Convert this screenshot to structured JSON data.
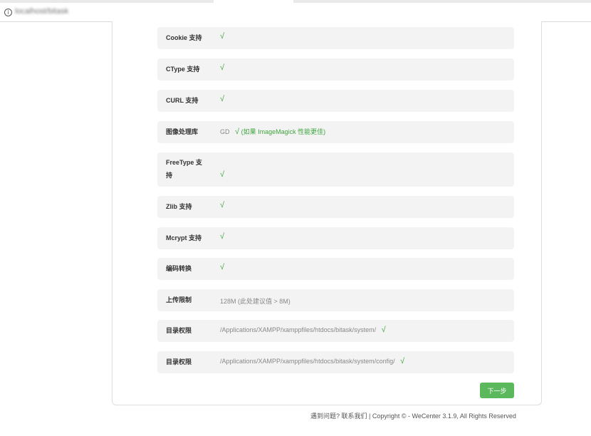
{
  "browser": {
    "url": "localhost/bitask",
    "info_icon": "i"
  },
  "checks": [
    {
      "label": "Cookie 支持",
      "value": "",
      "check": "√",
      "note": ""
    },
    {
      "label": "CType 支持",
      "value": "",
      "check": "√",
      "note": ""
    },
    {
      "label": "CURL 支持",
      "value": "",
      "check": "√",
      "note": ""
    },
    {
      "label": "图像处理库",
      "value": "GD",
      "check": "√",
      "note": "(如果 ImageMagick 性能更佳)"
    },
    {
      "label_line1": "FreeType 支",
      "label_line2": "持",
      "value": "",
      "check": "√",
      "note": ""
    },
    {
      "label": "Zlib 支持",
      "value": "",
      "check": "√",
      "note": ""
    },
    {
      "label": "Mcrypt 支持",
      "value": "",
      "check": "√",
      "note": ""
    },
    {
      "label": "编码转换",
      "value": "",
      "check": "√",
      "note": ""
    },
    {
      "label": "上传限制",
      "value": "128M (此处建议值 > 8M)",
      "check": "",
      "note": ""
    },
    {
      "label": "目录权限",
      "value": "/Applications/XAMPP/xamppfiles/htdocs/bitask/system/",
      "check": "√",
      "note": ""
    },
    {
      "label": "目录权限",
      "value": "/Applications/XAMPP/xamppfiles/htdocs/bitask/system/config/",
      "check": "√",
      "note": ""
    }
  ],
  "actions": {
    "next_label": "下一步"
  },
  "footer": {
    "help_text": "遇到问题?",
    "contact_link": "联系我们",
    "copyright": " | Copyright © - WeCenter 3.1.9, All Rights Reserved"
  },
  "colors": {
    "check_green": "#3fa53f",
    "button_green": "#5cb85c",
    "row_bg": "#f3f3f3"
  }
}
